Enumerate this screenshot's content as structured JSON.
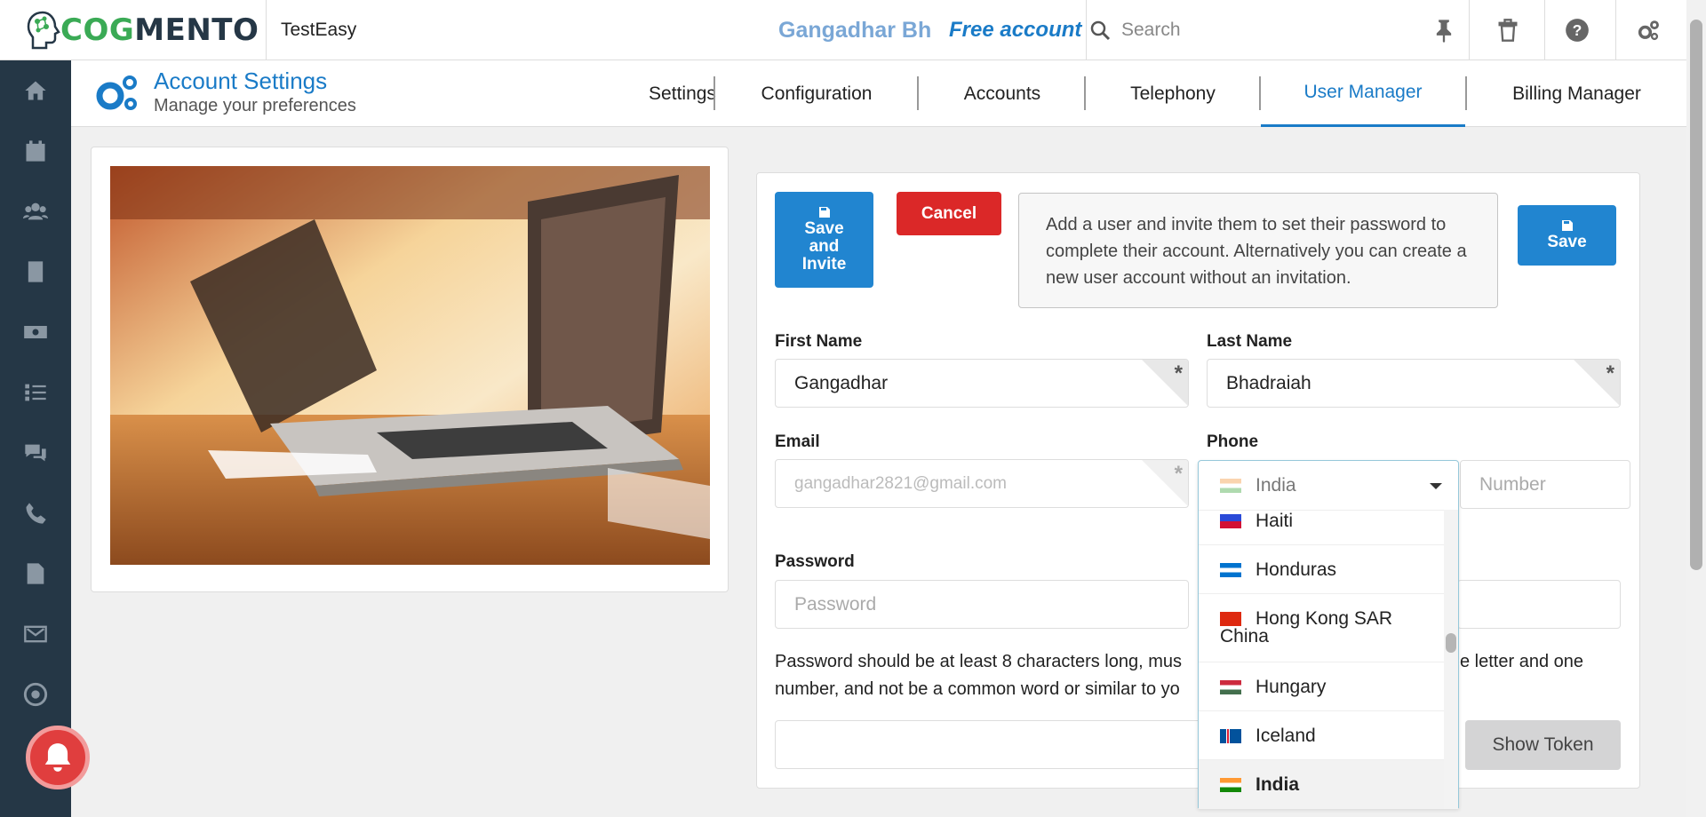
{
  "header": {
    "logo_cog": "COG",
    "logo_mento": "MENTO",
    "app_name": "TestEasy",
    "user_name": "Gangadhar Bh",
    "account_type": "Free account",
    "search_placeholder": "Search"
  },
  "sidebar": {
    "icons": [
      "home-icon",
      "calendar-icon",
      "contacts-icon",
      "companies-icon",
      "deals-icon",
      "tasks-icon",
      "chat-icon",
      "phone-icon",
      "documents-icon",
      "email-icon",
      "campaigns-icon"
    ]
  },
  "subheader": {
    "title": "Account Settings",
    "subtitle": "Manage your preferences",
    "tabs": [
      "Settings",
      "Configuration",
      "Accounts",
      "Telephony",
      "User Manager",
      "Billing Manager"
    ],
    "active_tab": "User Manager"
  },
  "form": {
    "save_invite_lines": [
      "Save",
      "and",
      "Invite"
    ],
    "cancel_label": "Cancel",
    "save_label": "Save",
    "info_text": "Add a user and invite them to set their password to complete their account. Alternatively you can create a new user account without an invitation.",
    "first_name_label": "First Name",
    "first_name_value": "Gangadhar",
    "last_name_label": "Last Name",
    "last_name_value": "Bhadraiah",
    "email_label": "Email",
    "email_value": "gangadhar2821@gmail.com",
    "phone_label": "Phone",
    "phone_country": "India",
    "number_placeholder": "Number",
    "password_label": "Password",
    "password_placeholder": "Password",
    "help_line1_a": "Password should be at least 8 characters long, mus",
    "help_line1_b": "e letter and one",
    "help_line2": "number, and not be a common word or similar to yo",
    "show_token_label": "Show Token"
  },
  "country_list": [
    {
      "name": "Haiti",
      "selected": false
    },
    {
      "name": "Honduras",
      "selected": false
    },
    {
      "name": "Hong Kong SAR China",
      "selected": false
    },
    {
      "name": "Hungary",
      "selected": false
    },
    {
      "name": "Iceland",
      "selected": false
    },
    {
      "name": "India",
      "selected": true
    }
  ],
  "colors": {
    "primary": "#2185d0",
    "danger": "#db2828",
    "sidebar": "#253746",
    "brand_green": "#3aaa55"
  }
}
